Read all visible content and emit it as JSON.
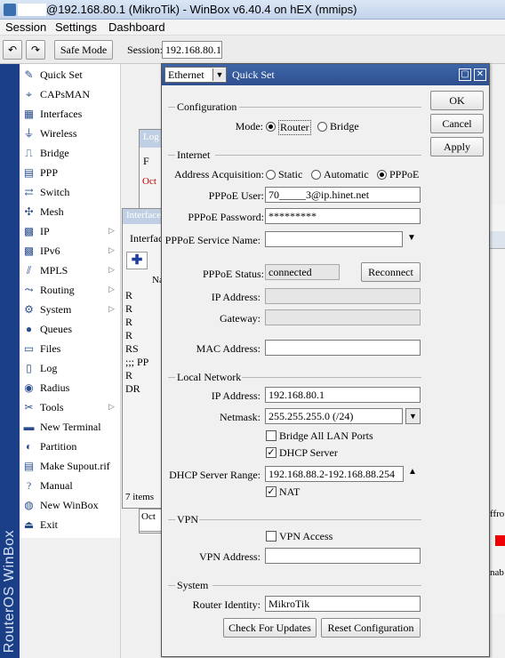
{
  "titlebar": {
    "title": "@192.168.80.1 (MikroTik) - WinBox v6.40.4 on hEX (mmips)"
  },
  "menu": [
    "Session",
    "Settings",
    "Dashboard"
  ],
  "toolbar": {
    "undo_icon": "undo-icon",
    "redo_icon": "redo-icon",
    "safe_mode": "Safe Mode",
    "session_label": "Session:",
    "session_value": "192.168.80.1"
  },
  "brand": "RouterOS WinBox",
  "sidebar": {
    "items": [
      {
        "label": "Quick Set",
        "icon": "quick-set-icon",
        "glyph": "✎",
        "arrow": false
      },
      {
        "label": "CAPsMAN",
        "icon": "capsman-icon",
        "glyph": "⌖",
        "arrow": false
      },
      {
        "label": "Interfaces",
        "icon": "interfaces-icon",
        "glyph": "▦",
        "arrow": false
      },
      {
        "label": "Wireless",
        "icon": "wireless-icon",
        "glyph": "⏚",
        "arrow": false
      },
      {
        "label": "Bridge",
        "icon": "bridge-icon",
        "glyph": "⎍",
        "arrow": false
      },
      {
        "label": "PPP",
        "icon": "ppp-icon",
        "glyph": "▤",
        "arrow": false
      },
      {
        "label": "Switch",
        "icon": "switch-icon",
        "glyph": "⇄",
        "arrow": false
      },
      {
        "label": "Mesh",
        "icon": "mesh-icon",
        "glyph": "✣",
        "arrow": false
      },
      {
        "label": "IP",
        "icon": "ip-icon",
        "glyph": "▩",
        "arrow": true
      },
      {
        "label": "IPv6",
        "icon": "ipv6-icon",
        "glyph": "▩",
        "arrow": true
      },
      {
        "label": "MPLS",
        "icon": "mpls-icon",
        "glyph": "⫽",
        "arrow": true
      },
      {
        "label": "Routing",
        "icon": "routing-icon",
        "glyph": "⤳",
        "arrow": true
      },
      {
        "label": "System",
        "icon": "system-icon",
        "glyph": "⚙",
        "arrow": true
      },
      {
        "label": "Queues",
        "icon": "queues-icon",
        "glyph": "●",
        "arrow": false
      },
      {
        "label": "Files",
        "icon": "files-icon",
        "glyph": "▭",
        "arrow": false
      },
      {
        "label": "Log",
        "icon": "log-icon",
        "glyph": "▯",
        "arrow": false
      },
      {
        "label": "Radius",
        "icon": "radius-icon",
        "glyph": "◉",
        "arrow": false
      },
      {
        "label": "Tools",
        "icon": "tools-icon",
        "glyph": "✂",
        "arrow": true
      },
      {
        "label": "New Terminal",
        "icon": "terminal-icon",
        "glyph": "▬",
        "arrow": false
      },
      {
        "label": "Partition",
        "icon": "partition-icon",
        "glyph": "◐",
        "arrow": false
      },
      {
        "label": "Make Supout.rif",
        "icon": "supout-icon",
        "glyph": "▤",
        "arrow": false
      },
      {
        "label": "Manual",
        "icon": "manual-icon",
        "glyph": "?",
        "arrow": false
      },
      {
        "label": "New WinBox",
        "icon": "winbox-icon",
        "glyph": "◍",
        "arrow": false
      },
      {
        "label": "Exit",
        "icon": "exit-icon",
        "glyph": "⏏",
        "arrow": false
      }
    ]
  },
  "bg": {
    "log_title": "Log",
    "log_col": "F",
    "log_line": "Oct",
    "iface_title": "Interface",
    "iface_tab": "Interfac",
    "iface_name_col": "Na",
    "iface_rows": [
      "R",
      "R",
      "R",
      "R",
      "RS",
      ";;; PP",
      "R",
      "DR"
    ],
    "iface_count": "7 items",
    "bottom_log": "Oct",
    "right_frag1": "ffro",
    "right_frag2": "nab"
  },
  "dialog": {
    "mode_select": "Ethernet",
    "title": "Quick Set",
    "buttons": {
      "ok": "OK",
      "cancel": "Cancel",
      "apply": "Apply"
    },
    "configuration": {
      "section": "Configuration",
      "mode_label": "Mode:",
      "router": "Router",
      "bridge": "Bridge",
      "selected": "Router"
    },
    "internet": {
      "section": "Internet",
      "acq_label": "Address Acquisition:",
      "acq_static": "Static",
      "acq_auto": "Automatic",
      "acq_pppoe": "PPPoE",
      "acq_selected": "PPPoE",
      "user_label": "PPPoE User:",
      "user_value": "70_____3@ip.hinet.net",
      "password_label": "PPPoE Password:",
      "password_value": "*********",
      "service_label": "PPPoE Service Name:",
      "service_value": "",
      "status_label": "PPPoE Status:",
      "status_value": "connected",
      "reconnect": "Reconnect",
      "ip_label": "IP Address:",
      "ip_value": "",
      "gateway_label": "Gateway:",
      "gateway_value": "",
      "mac_label": "MAC Address:",
      "mac_value": ""
    },
    "local": {
      "section": "Local Network",
      "ip_label": "IP Address:",
      "ip_value": "192.168.80.1",
      "netmask_label": "Netmask:",
      "netmask_value": "255.255.255.0 (/24)",
      "bridge_all": "Bridge All LAN Ports",
      "bridge_all_checked": false,
      "dhcp_server": "DHCP Server",
      "dhcp_server_checked": true,
      "range_label": "DHCP Server Range:",
      "range_value": "192.168.88.2-192.168.88.254",
      "nat": "NAT",
      "nat_checked": true
    },
    "vpn": {
      "section": "VPN",
      "access": "VPN Access",
      "access_checked": false,
      "address_label": "VPN Address:",
      "address_value": ""
    },
    "system": {
      "section": "System",
      "identity_label": "Router Identity:",
      "identity_value": "MikroTik",
      "check_updates": "Check For Updates",
      "reset": "Reset Configuration"
    }
  },
  "colors": {
    "brand_strip": "#1b3f86",
    "dialog_title": "#3e66a8"
  }
}
